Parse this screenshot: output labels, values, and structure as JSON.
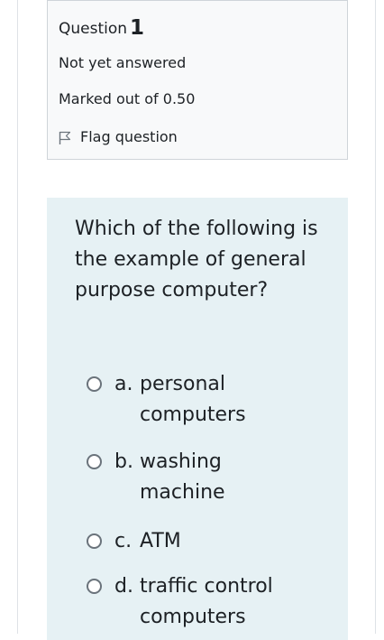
{
  "question_info": {
    "label": "Question",
    "number": "1",
    "state": "Not yet answered",
    "grade": "Marked out of 0.50",
    "flag_label": "Flag question",
    "flag_icon": "flag-outline-icon"
  },
  "question": {
    "text": "Which of the following is the example of general purpose computer?",
    "answers": [
      {
        "letter": "a.",
        "text": "personal computers",
        "selected": false
      },
      {
        "letter": "b.",
        "text": "washing machine",
        "selected": false
      },
      {
        "letter": "c.",
        "text": "ATM",
        "selected": false
      },
      {
        "letter": "d.",
        "text": "traffic control computers",
        "selected": false
      }
    ]
  },
  "colors": {
    "info_background": "#f8f9fa",
    "content_background": "#e6f1f4",
    "text": "#1d2125",
    "border": "#cfd4d9"
  }
}
